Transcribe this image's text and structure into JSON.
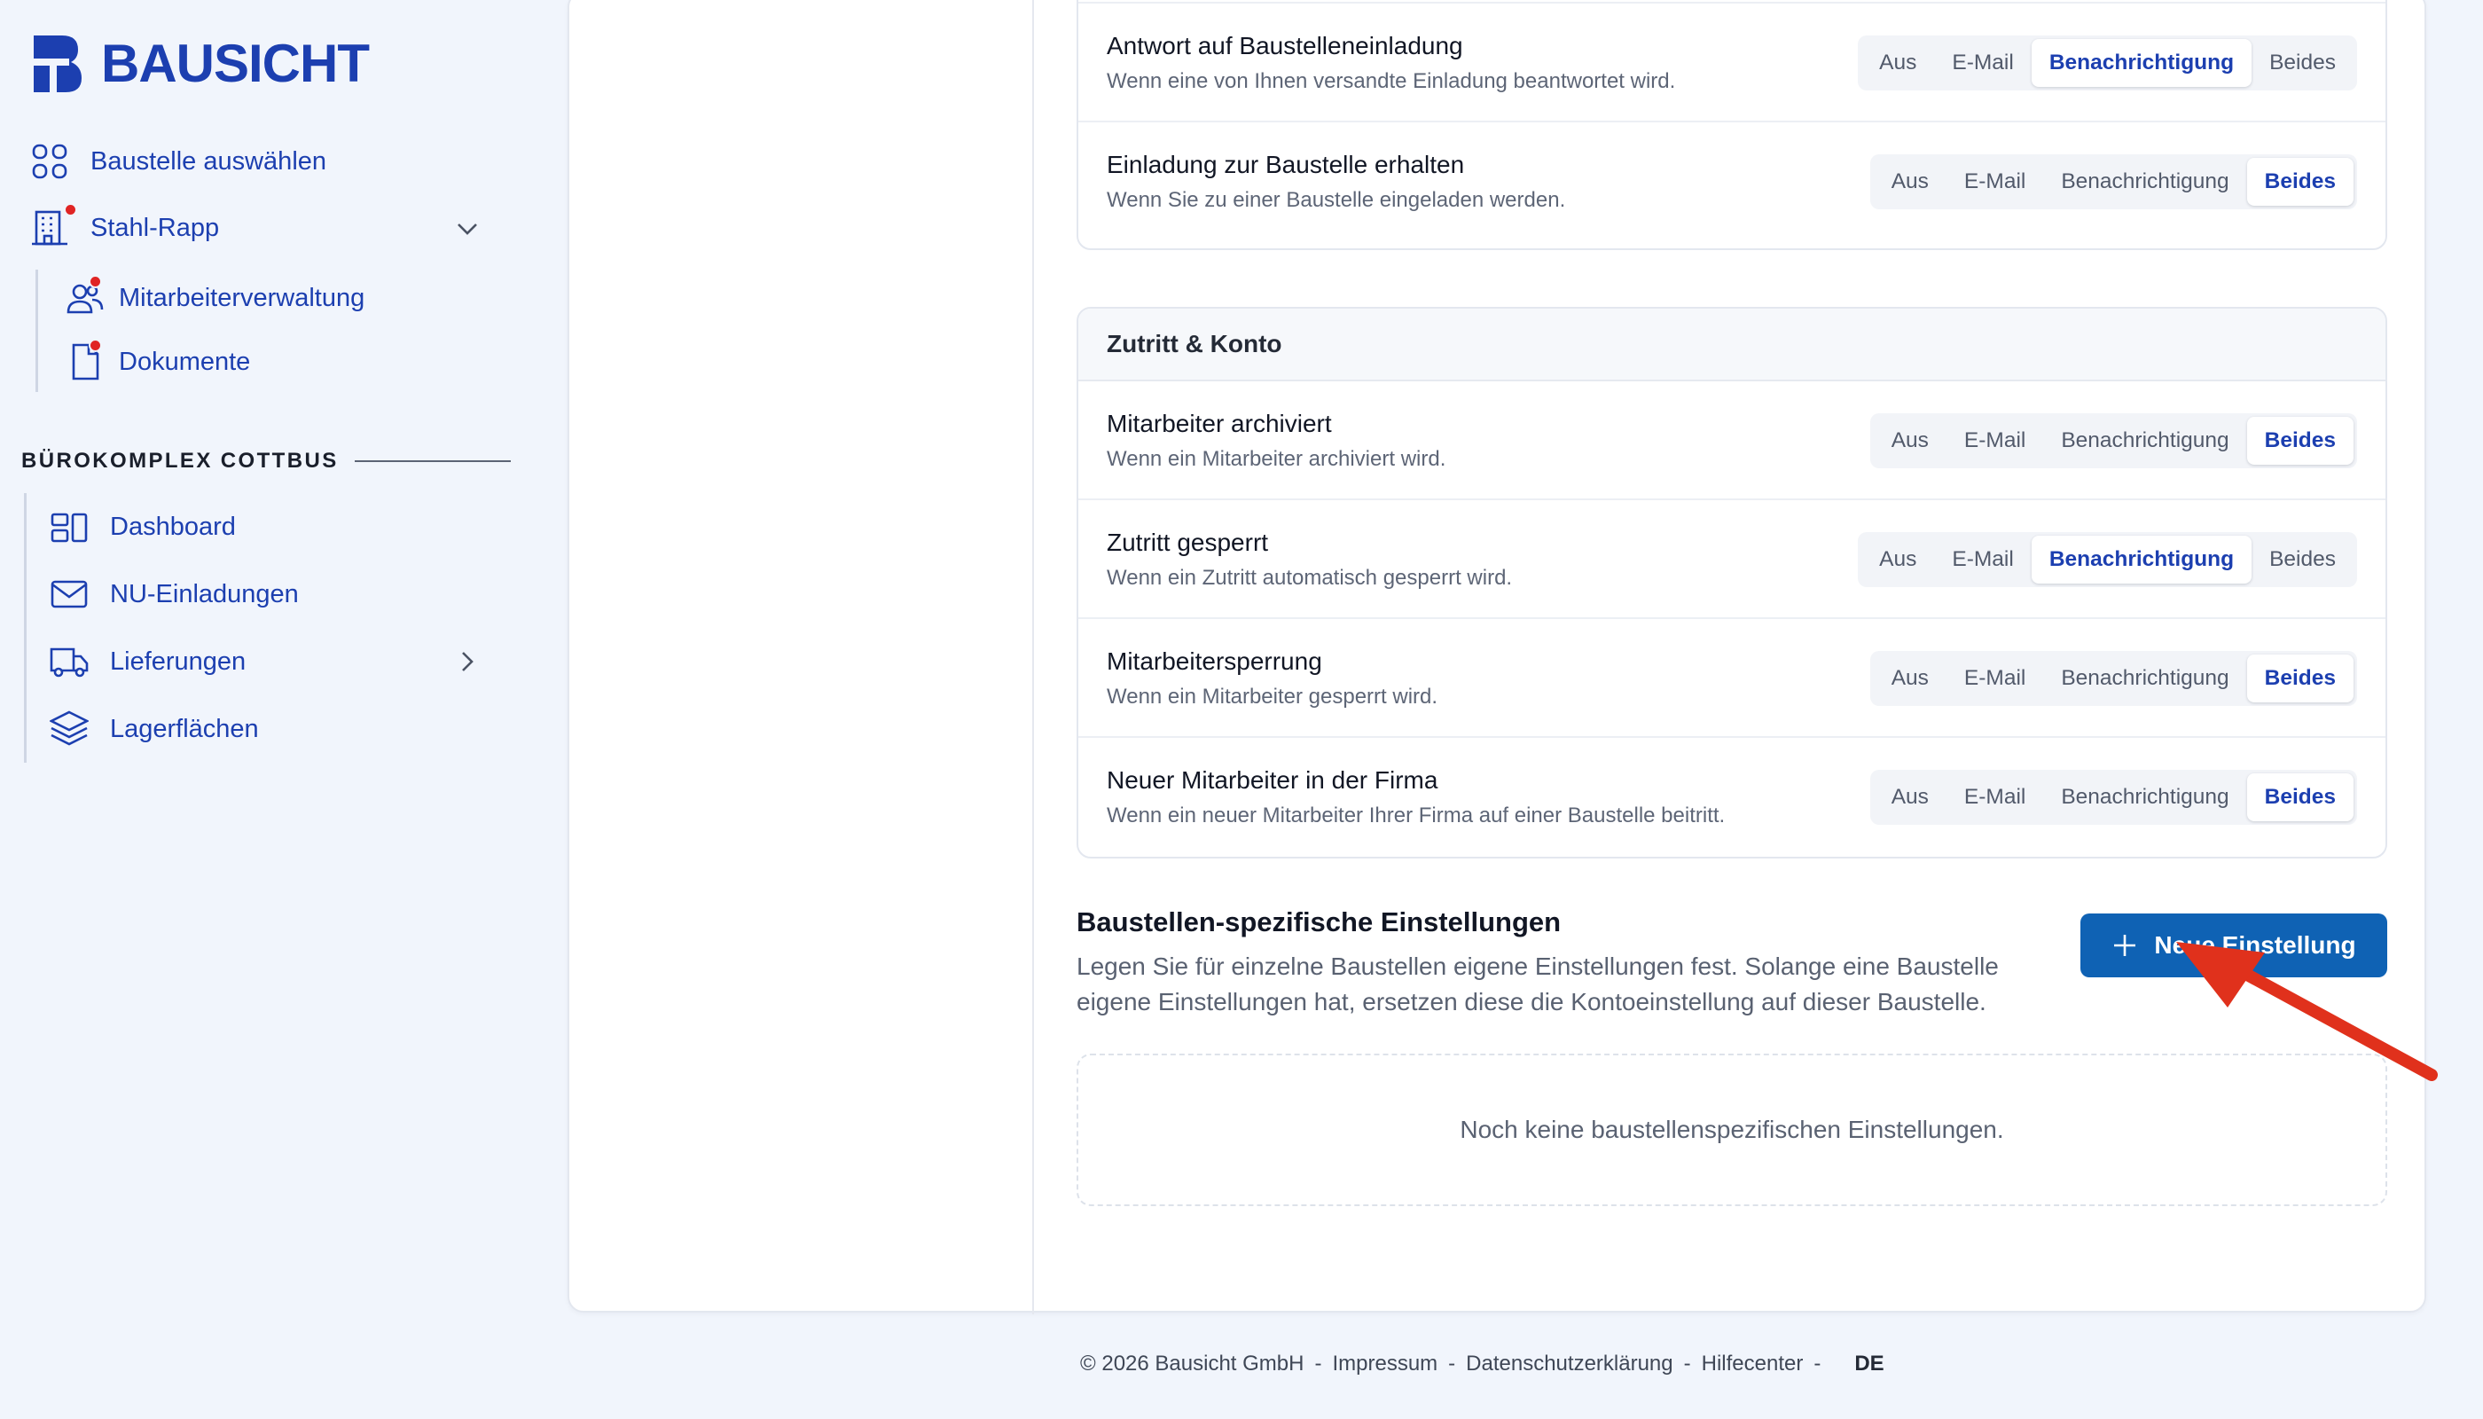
{
  "brand": {
    "name": "BAUSICHT",
    "color": "#1c3fb0"
  },
  "sidebar": {
    "select_site": "Baustelle auswählen",
    "company": "Stahl-Rapp",
    "company_items": [
      {
        "label": "Mitarbeiterverwaltung",
        "icon": "users-icon"
      },
      {
        "label": "Dokumente",
        "icon": "document-icon"
      }
    ],
    "section_title": "BÜROKOMPLEX COTTBUS",
    "site_items": [
      {
        "label": "Dashboard",
        "icon": "dashboard-icon"
      },
      {
        "label": "NU-Einladungen",
        "icon": "mail-icon"
      },
      {
        "label": "Lieferungen",
        "icon": "truck-icon"
      },
      {
        "label": "Lagerflächen",
        "icon": "layers-icon"
      }
    ]
  },
  "options": [
    "Aus",
    "E-Mail",
    "Benachrichtigung",
    "Beides"
  ],
  "group1": {
    "rows": [
      {
        "title": "Antwort auf Baustelleneinladung",
        "desc": "Wenn eine von Ihnen versandte Einladung beantwortet wird.",
        "selected": "Benachrichtigung"
      },
      {
        "title": "Einladung zur Baustelle erhalten",
        "desc": "Wenn Sie zu einer Baustelle eingeladen werden.",
        "selected": "Beides"
      }
    ]
  },
  "group2": {
    "title": "Zutritt & Konto",
    "rows": [
      {
        "title": "Mitarbeiter archiviert",
        "desc": "Wenn ein Mitarbeiter archiviert wird.",
        "selected": "Beides"
      },
      {
        "title": "Zutritt gesperrt",
        "desc": "Wenn ein Zutritt automatisch gesperrt wird.",
        "selected": "Benachrichtigung"
      },
      {
        "title": "Mitarbeitersperrung",
        "desc": "Wenn ein Mitarbeiter gesperrt wird.",
        "selected": "Beides"
      },
      {
        "title": "Neuer Mitarbeiter in der Firma",
        "desc": "Wenn ein neuer Mitarbeiter Ihrer Firma auf einer Baustelle beitritt.",
        "selected": "Beides"
      }
    ]
  },
  "specific": {
    "title": "Baustellen-spezifische Einstellungen",
    "desc": "Legen Sie für einzelne Baustellen eigene Einstellungen fest. Solange eine Baustelle eigene Einstellungen hat, ersetzen diese die Kontoeinstellung auf dieser Baustelle.",
    "button": "Neue Einstellung",
    "empty": "Noch keine baustellenspezifischen Einstellungen."
  },
  "footer": {
    "copyright": "© 2026 Bausicht GmbH",
    "links": [
      "Impressum",
      "Datenschutzerklärung",
      "Hilfecenter"
    ],
    "lang": "DE"
  },
  "colors": {
    "accent": "#0f62b4",
    "annotation_arrow": "#e0311c",
    "notification_dot": "#e02424"
  }
}
